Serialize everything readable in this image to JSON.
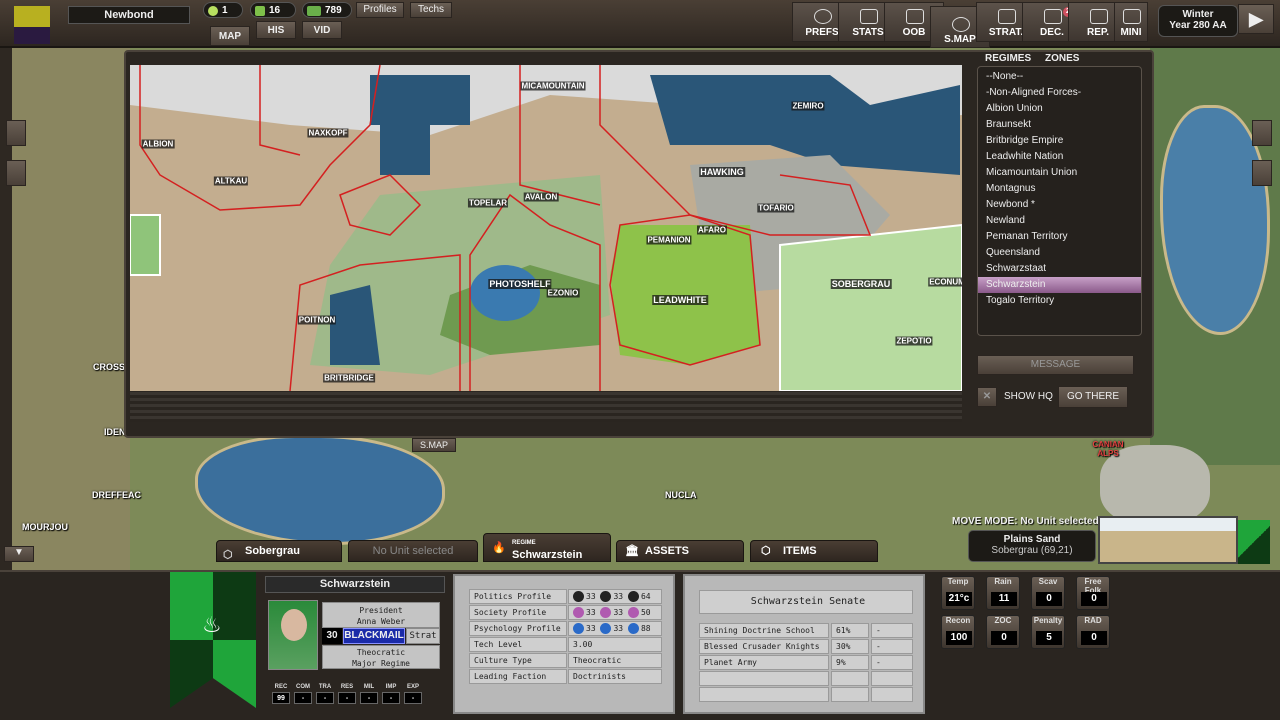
{
  "top": {
    "faction_name": "Newbond",
    "resources": [
      {
        "icon": "sun-icon",
        "value": "1"
      },
      {
        "icon": "fist-icon",
        "value": "16"
      },
      {
        "icon": "money-icon",
        "value": "789"
      }
    ],
    "profiles_label": "Profiles",
    "techs_label": "Techs",
    "view_tabs": [
      "MAP",
      "HIS",
      "VID"
    ],
    "menu": [
      {
        "label": "PREFS",
        "icon": "gear-icon"
      },
      {
        "label": "STATS",
        "icon": "chart-icon"
      },
      {
        "label": "OOB",
        "icon": "hierarchy-icon"
      },
      {
        "label": "S.MAP",
        "icon": "globe-icon"
      },
      {
        "label": "STRAT.",
        "icon": "cards-icon"
      },
      {
        "label": "DEC.",
        "icon": "envelope-icon",
        "badge": "2"
      },
      {
        "label": "REP.",
        "icon": "report-icon"
      },
      {
        "label": "MINI",
        "icon": "map-pin-icon"
      }
    ],
    "season": "Winter",
    "year": "Year 280 AA"
  },
  "strategic_map": {
    "tab_label": "S.MAP",
    "cities": [
      "MICAMOUNTAIN",
      "ZEMIRO",
      "ALBION",
      "NAXKOPF",
      "ALTKAU",
      "HAWKING",
      "TOPELAR",
      "AVALON",
      "TOFARIO",
      "AFARO",
      "PEMANION",
      "PHOTOSHELF",
      "EZONIO",
      "LEADWHITE",
      "SOBERGRAU",
      "ECONUM",
      "POITNON",
      "BRITBRIDGE",
      "ZEPOTIO"
    ],
    "list_tabs": [
      "REGIMES",
      "ZONES"
    ],
    "regimes": [
      "--None--",
      "-Non-Aligned Forces-",
      "Albion Union",
      "Braunsekt",
      "Britbridge Empire",
      "Leadwhite Nation",
      "Micamountain Union",
      "Montagnus",
      "Newbond *",
      "Newland",
      "Pemanan Territory",
      "Queensland",
      "Schwarzstaat",
      "Schwarzstein",
      "Togalo Territory"
    ],
    "selected_regime": "Schwarzstein",
    "message_label": "MESSAGE",
    "show_hq_label": "SHOW HQ",
    "show_hq_checked": true,
    "go_there_label": "GO THERE"
  },
  "world_map": {
    "towns": [
      "CROSS",
      "IDEN",
      "DREFFEAC",
      "MOURJOU",
      "NUCLA"
    ],
    "region_label": "CANIAN ALPS"
  },
  "bottom_tabs": {
    "zone": "Sobergrau",
    "unit": "No Unit selected",
    "regime_caption": "REGIME",
    "regime": "Schwarzstein",
    "assets": "ASSETS",
    "items": "ITEMS"
  },
  "hex_info": {
    "move_mode": "MOVE MODE: No Unit selected",
    "terrain": "Plains Sand",
    "location": "Sobergrau (69,21)"
  },
  "regime_panel": {
    "name": "Schwarzstein",
    "leader_title": "President",
    "leader_name": "Anna Weber",
    "skill_value": "30",
    "skill_name": "BLACKMAIL",
    "skill_type": "Strat",
    "government": "Theocratic",
    "regime_class": "Major Regime",
    "mini_stats": [
      {
        "label": "REC",
        "value": "99"
      },
      {
        "label": "COM",
        "value": "-"
      },
      {
        "label": "TRA",
        "value": "-"
      },
      {
        "label": "RES",
        "value": "-"
      },
      {
        "label": "MIL",
        "value": "-"
      },
      {
        "label": "IMP",
        "value": "-"
      },
      {
        "label": "EXP",
        "value": "-"
      }
    ],
    "banner_colors": [
      "#1fa53a",
      "#0d3a14"
    ]
  },
  "profile": {
    "rows": [
      {
        "label": "Politics Profile",
        "values": [
          {
            "icon": "star-icon",
            "v": "33",
            "color": "#222"
          },
          {
            "icon": "crown-icon",
            "v": "33",
            "color": "#222"
          },
          {
            "icon": "bank-icon",
            "v": "64",
            "color": "#222"
          }
        ]
      },
      {
        "label": "Society Profile",
        "values": [
          {
            "icon": "eye-icon",
            "v": "33",
            "color": "#b05ab0"
          },
          {
            "icon": "people-icon",
            "v": "33",
            "color": "#b05ab0"
          },
          {
            "icon": "hammer-sickle-icon",
            "v": "50",
            "color": "#b05ab0"
          }
        ]
      },
      {
        "label": "Psychology Profile",
        "values": [
          {
            "icon": "slash-icon",
            "v": "33",
            "color": "#2a6ac8"
          },
          {
            "icon": "graduate-icon",
            "v": "33",
            "color": "#2a6ac8"
          },
          {
            "icon": "shield-icon",
            "v": "88",
            "color": "#2a6ac8"
          }
        ]
      },
      {
        "label": "Tech Level",
        "text": "3.00"
      },
      {
        "label": "Culture Type",
        "text": "Theocratic"
      },
      {
        "label": "Leading Faction",
        "text": "Doctrinists"
      }
    ]
  },
  "senate": {
    "title": "Schwarzstein Senate",
    "rows": [
      {
        "name": "Shining Doctrine School",
        "share": "61%",
        "extra": "-"
      },
      {
        "name": "Blessed Crusader Knights",
        "share": "30%",
        "extra": "-"
      },
      {
        "name": "Planet Army",
        "share": "9%",
        "extra": "-"
      }
    ]
  },
  "hex_stats": [
    {
      "label": "Temp",
      "value": "21°c"
    },
    {
      "label": "Rain",
      "value": "11"
    },
    {
      "label": "Scav",
      "value": "0"
    },
    {
      "label": "Free Folk",
      "value": "0"
    },
    {
      "label": "Recon",
      "value": "100"
    },
    {
      "label": "ZOC",
      "value": "0"
    },
    {
      "label": "Penalty",
      "value": "5"
    },
    {
      "label": "RAD",
      "value": "0"
    }
  ]
}
